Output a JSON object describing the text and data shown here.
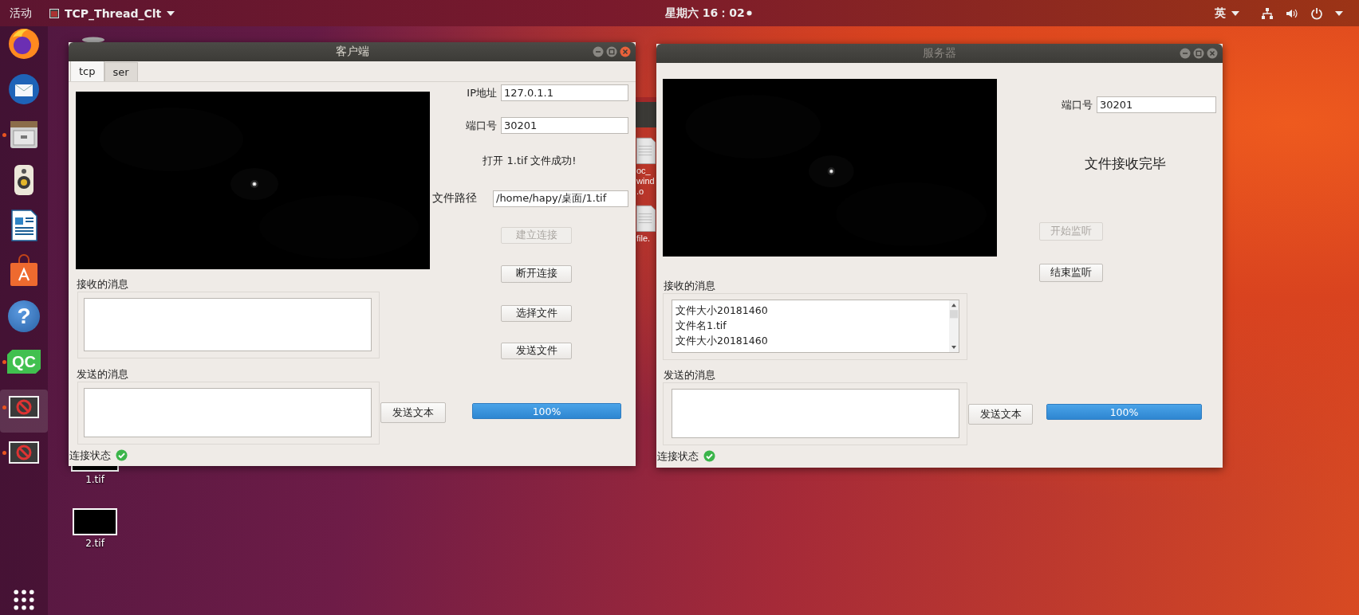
{
  "top_bar": {
    "activities": "活动",
    "app_menu": "TCP_Thread_Clt",
    "clock": "星期六 16：02",
    "notification": true,
    "input_method": "英"
  },
  "dock": {
    "items": [
      {
        "kind": "browser",
        "running": false,
        "focused": false
      },
      {
        "kind": "mail",
        "running": false,
        "focused": false
      },
      {
        "kind": "files",
        "running": true,
        "focused": false
      },
      {
        "kind": "music",
        "running": false,
        "focused": false
      },
      {
        "kind": "writer",
        "running": false,
        "focused": false
      },
      {
        "kind": "store",
        "running": false,
        "focused": false
      },
      {
        "kind": "help",
        "glyph": "?",
        "running": false,
        "focused": false
      },
      {
        "kind": "qc",
        "glyph": "QC",
        "running": true,
        "focused": false
      },
      {
        "kind": "app",
        "running": true,
        "focused": true
      },
      {
        "kind": "app",
        "running": true,
        "focused": false
      }
    ]
  },
  "desktop_icons": [
    {
      "label": "1.tif"
    },
    {
      "label": "2.tif"
    }
  ],
  "background_files": [
    {
      "lines": [
        "oc_",
        "wind",
        ".o"
      ]
    },
    {
      "lines": [
        "file."
      ]
    }
  ],
  "client_window": {
    "title": "客户端",
    "active": true,
    "tabs": [
      {
        "label": "tcp",
        "selected": true
      },
      {
        "label": "ser",
        "selected": false
      }
    ],
    "ip_label": "IP地址",
    "ip": "127.0.1.1",
    "port_label": "端口号",
    "port": "30201",
    "status_message": "打开 1.tif 文件成功!",
    "path_label": "文件路径",
    "path": "/home/hapy/桌面/1.tif",
    "buttons": [
      {
        "label": "建立连接",
        "disabled": true
      },
      {
        "label": "断开连接",
        "disabled": false
      },
      {
        "label": "选择文件",
        "disabled": false
      },
      {
        "label": "发送文件",
        "disabled": false
      }
    ],
    "received_label": "接收的消息",
    "sent_label": "发送的消息",
    "send_text_button": "发送文本",
    "progress": {
      "level": 1,
      "text": "100%"
    },
    "connection_label": "连接状态",
    "connected": true
  },
  "server_window": {
    "title": "服务器",
    "active": false,
    "port_label": "端口号",
    "port": "30201",
    "status_message": "文件接收完毕",
    "buttons": [
      {
        "label": "开始监听",
        "disabled": true
      },
      {
        "label": "结束监听",
        "disabled": false
      }
    ],
    "received_label": "接收的消息",
    "received_messages": [
      "文件大小20181460",
      "文件名1.tif",
      "文件大小20181460"
    ],
    "sent_label": "发送的消息",
    "send_text_button": "发送文本",
    "progress": {
      "level": 1,
      "text": "100%"
    },
    "connection_label": "连接状态",
    "connected": true
  }
}
